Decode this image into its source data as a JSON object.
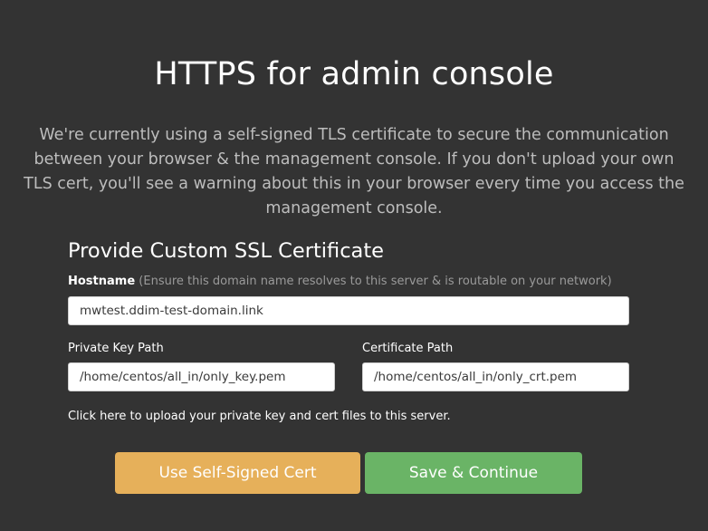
{
  "header": {
    "title": "HTTPS for admin console"
  },
  "intro": {
    "text": "We're currently using a self-signed TLS certificate to secure the communication between your browser & the management console. If you don't upload your own TLS cert, you'll see a warning about this in your browser every time you access the management console."
  },
  "form": {
    "section_title": "Provide Custom SSL Certificate",
    "hostname": {
      "label": "Hostname",
      "hint": " (Ensure this domain name resolves to this server & is routable on your network)",
      "value": "mwtest.ddim-test-domain.link"
    },
    "private_key": {
      "label": "Private Key Path",
      "value": "/home/centos/all_in/only_key.pem"
    },
    "certificate": {
      "label": "Certificate Path",
      "value": "/home/centos/all_in/only_crt.pem"
    },
    "upload_link": "Click here to upload your private key and cert files to this server."
  },
  "actions": {
    "self_signed_label": "Use Self-Signed Cert",
    "save_label": "Save & Continue"
  },
  "colors": {
    "background": "#333333",
    "self_signed_button": "#e6b05a",
    "save_button": "#6ab466"
  }
}
